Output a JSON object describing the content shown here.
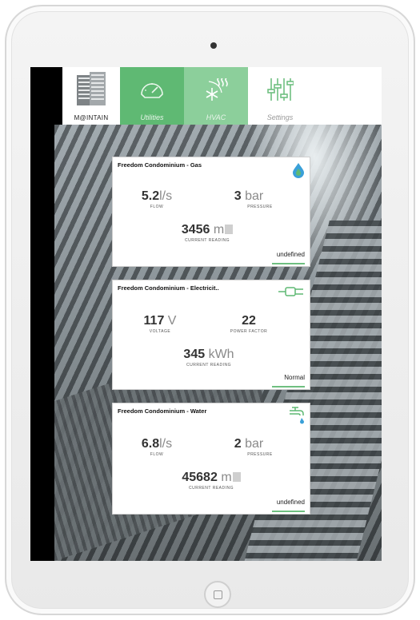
{
  "nav": {
    "brand": "M@INTAIN",
    "items": [
      {
        "label": "Utilities",
        "icon": "gauge-icon"
      },
      {
        "label": "HVAC",
        "icon": "snowflake-heat-icon"
      },
      {
        "label": "Settings",
        "icon": "sliders-icon"
      }
    ]
  },
  "cards": [
    {
      "title": "Freedom Condominium - Gas",
      "icon": "flame-drop-icon",
      "m1_value": "5.2",
      "m1_unit": "l/s",
      "m1_cap": "FLOW",
      "m2_value": "3",
      "m2_unit": "bar",
      "m2_cap": "PRESSURE",
      "reading_value": "3456",
      "reading_unit": "m",
      "reading_cap": "CURRENT READING",
      "status": "undefined"
    },
    {
      "title": "Freedom Condominium - Electricit..",
      "icon": "plug-icon",
      "m1_value": "117",
      "m1_unit": "V",
      "m1_cap": "VOLTAGE",
      "m2_value": "22",
      "m2_unit": "",
      "m2_cap": "POWER FACTOR",
      "reading_value": "345",
      "reading_unit": "kWh",
      "reading_cap": "CURRENT READING",
      "status": "Normal"
    },
    {
      "title": "Freedom Condominium - Water",
      "icon": "faucet-icon",
      "m1_value": "6.8",
      "m1_unit": "l/s",
      "m1_cap": "FLOW",
      "m2_value": "2",
      "m2_unit": "bar",
      "m2_cap": "PRESSURE",
      "reading_value": "45682",
      "reading_unit": "m",
      "reading_cap": "CURRENT READING",
      "status": "undefined"
    }
  ],
  "colors": {
    "accent": "#5fb973",
    "accent_light": "#8ccf9b",
    "water_blue": "#3aa0d8"
  }
}
